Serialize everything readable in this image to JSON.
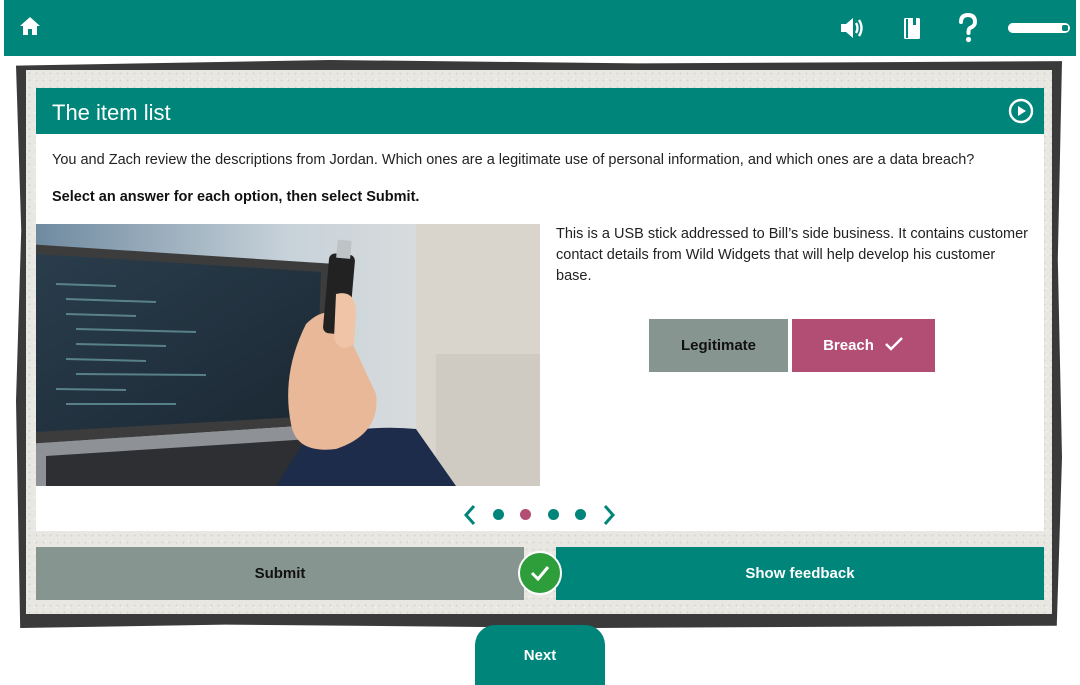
{
  "topbar": {
    "icons": [
      "home-icon",
      "audio-icon",
      "book-icon",
      "help-icon"
    ],
    "progress": 0.85
  },
  "card": {
    "title": "The item list",
    "question": "You and Zach review the descriptions from Jordan. Which ones are a legitimate use of personal information, and which ones are a data breach?",
    "instruction": "Select an answer for each option, then select Submit.",
    "item": {
      "description": "This is a USB stick addressed to Bill’s side business. It contains customer contact details from Wild Widgets that will help develop his customer base.",
      "options": [
        "Legitimate",
        "Breach"
      ],
      "selected": "Breach"
    },
    "pager": {
      "total": 4,
      "current": 2
    }
  },
  "actions": {
    "submit_label": "Submit",
    "feedback_label": "Show feedback",
    "next_label": "Next"
  },
  "colors": {
    "teal": "#00857a",
    "grey_button": "#879591",
    "breach_pink": "#b24d73",
    "success_green": "#2e9e3a"
  }
}
